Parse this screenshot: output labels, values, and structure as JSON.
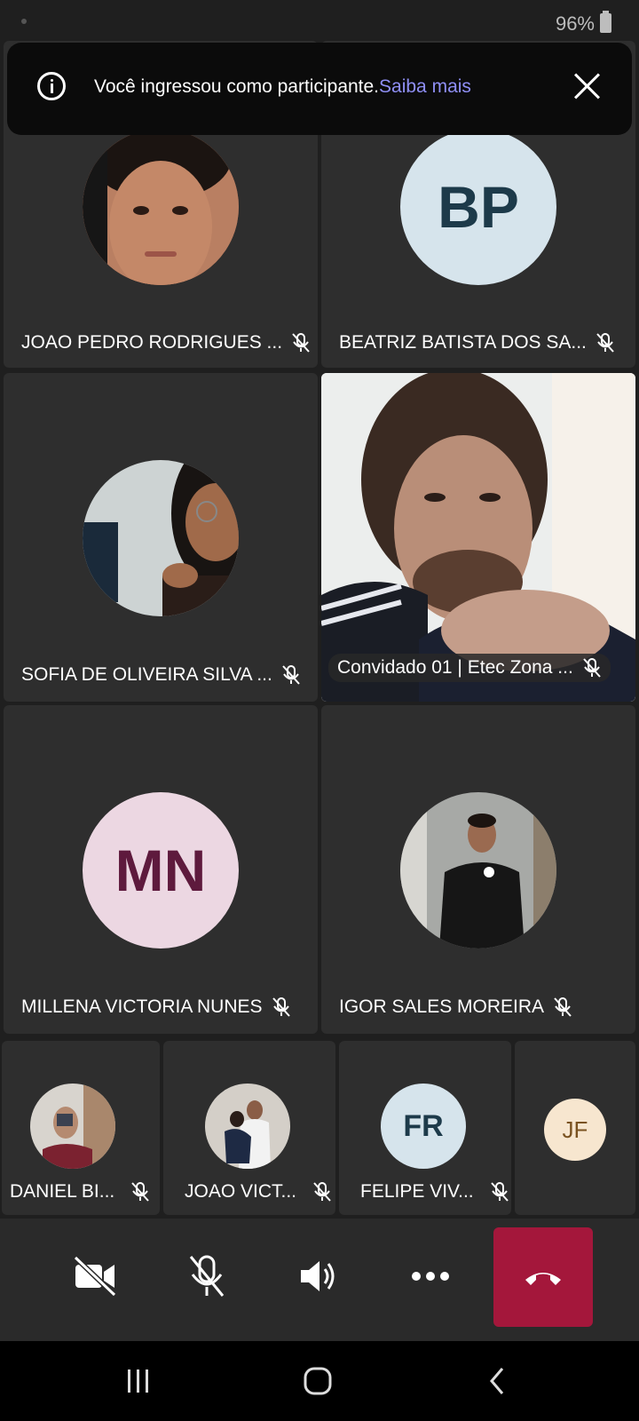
{
  "status_bar": {
    "battery": "96%"
  },
  "toast": {
    "message": "Você ingressou como participante.",
    "link": "Saiba mais"
  },
  "participants": {
    "p1": {
      "name": "JOAO PEDRO RODRIGUES ..."
    },
    "p2": {
      "name": "BEATRIZ BATISTA DOS SA...",
      "initials": "BP"
    },
    "p3": {
      "name": "SOFIA DE OLIVEIRA SILVA ..."
    },
    "p4": {
      "name": "Convidado 01 | Etec Zona ..."
    },
    "p5": {
      "name": "MILLENA VICTORIA NUNES",
      "initials": "MN"
    },
    "p6": {
      "name": "IGOR SALES MOREIRA"
    },
    "p7": {
      "name": "DANIEL BI..."
    },
    "p8": {
      "name": "JOAO VICT..."
    },
    "p9": {
      "name": "FELIPE VIV...",
      "initials": "FR"
    },
    "p10": {
      "initials": "JF"
    }
  },
  "colors": {
    "accent_link": "#8f8ff5",
    "hangup": "#a4173b",
    "bp_bg": "#d6e4ec",
    "bp_text": "#1d3a4a",
    "mn_bg": "#ecd7e2",
    "mn_text": "#5e1a3d",
    "fr_bg": "#d6e4ec",
    "fr_text": "#1d3a4a",
    "jf_bg": "#f7e6cf",
    "jf_text": "#7a5220"
  },
  "icons": {
    "controls": [
      "camera-off-icon",
      "mic-off-icon",
      "speaker-icon",
      "more-icon",
      "hangup-icon"
    ],
    "nav": [
      "recents-icon",
      "home-icon",
      "back-icon"
    ]
  }
}
